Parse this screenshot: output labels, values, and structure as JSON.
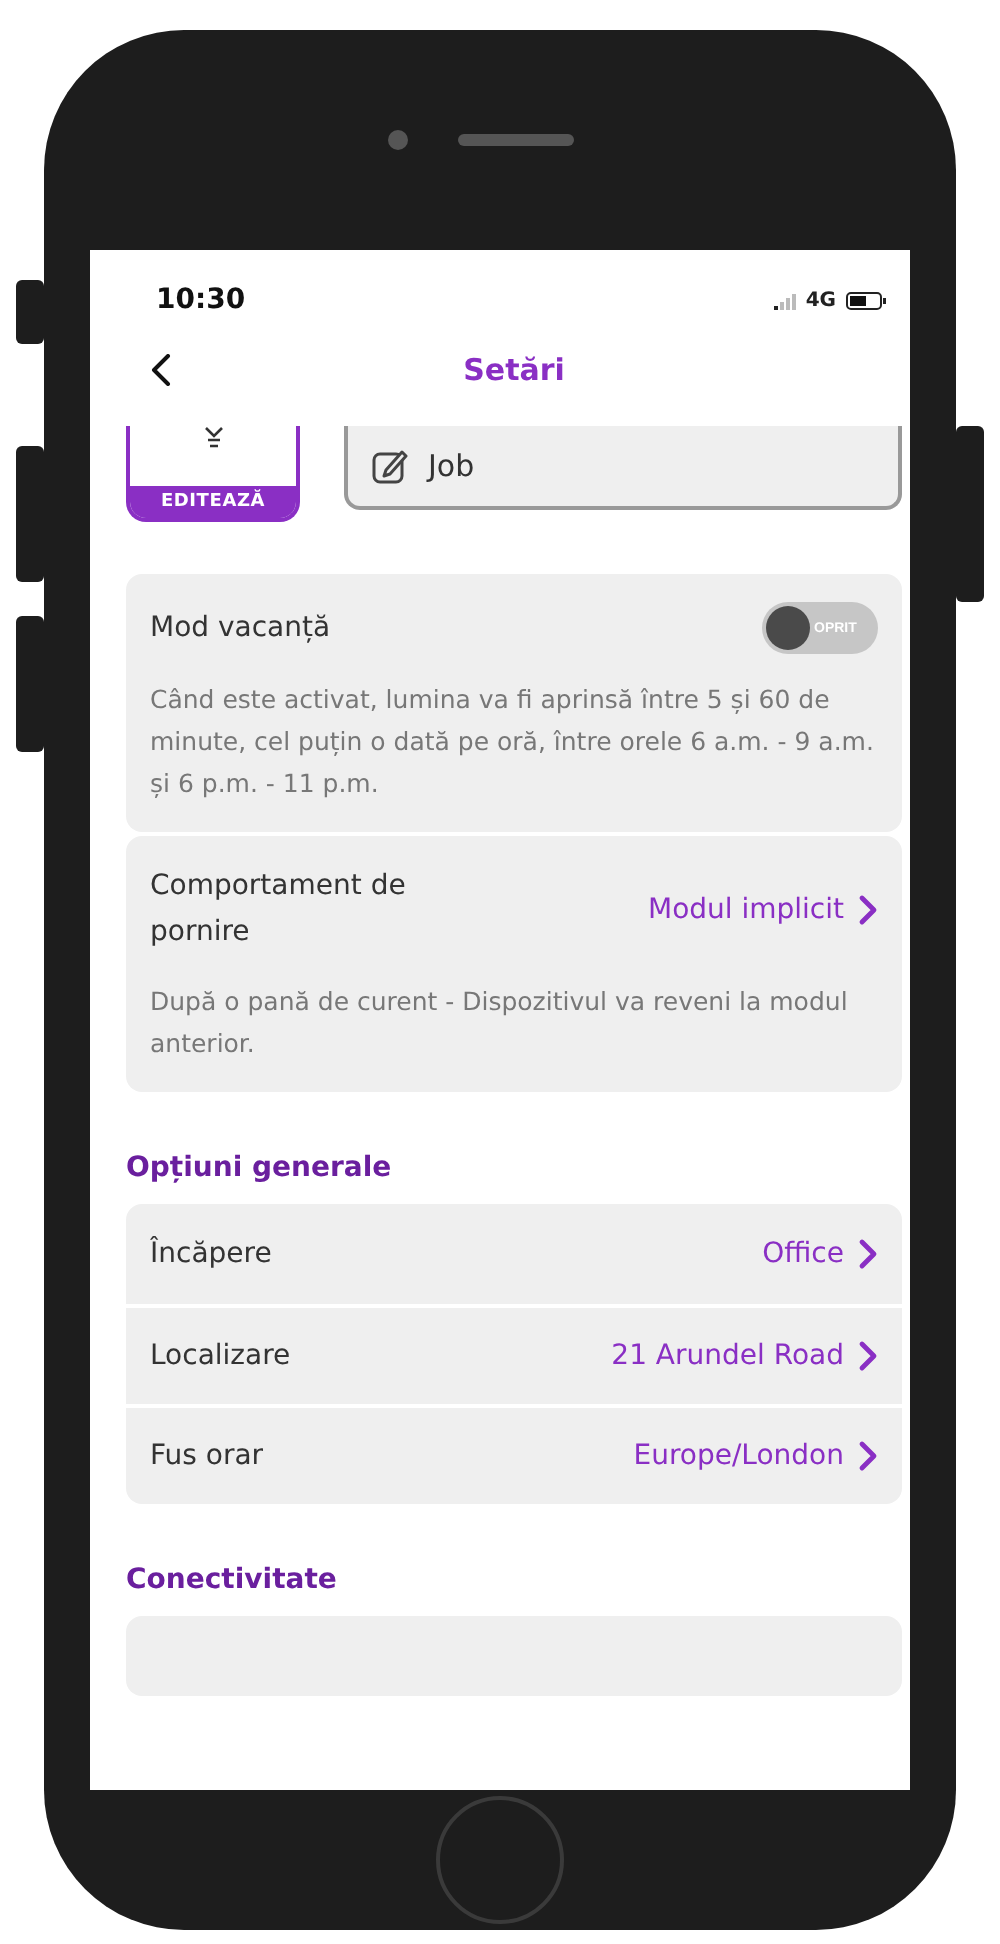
{
  "status_bar": {
    "time": "10:30",
    "network": "4G"
  },
  "header": {
    "title": "Setări"
  },
  "device": {
    "edit_label": "EDITEAZĂ",
    "name": "Job"
  },
  "vacation": {
    "label": "Mod vacanță",
    "toggle": {
      "on": false,
      "label": "OPRIT"
    },
    "description": "Când este activat, lumina va fi aprinsă între 5 și 60 de minute, cel puțin o dată pe oră, între orele 6 a.m. - 9 a.m. și 6 p.m. - 11 p.m."
  },
  "startup": {
    "label": "Comportament de pornire",
    "value": "Modul implicit",
    "description": "După o pană de curent - Dispozitivul va reveni la modul anterior."
  },
  "sections": [
    {
      "title": "Opțiuni generale",
      "rows": [
        {
          "label": "Încăpere",
          "value": "Office"
        },
        {
          "label": "Localizare",
          "value": "21 Arundel Road"
        },
        {
          "label": "Fus orar",
          "value": "Europe/London"
        }
      ]
    },
    {
      "title": "Conectivitate"
    }
  ]
}
